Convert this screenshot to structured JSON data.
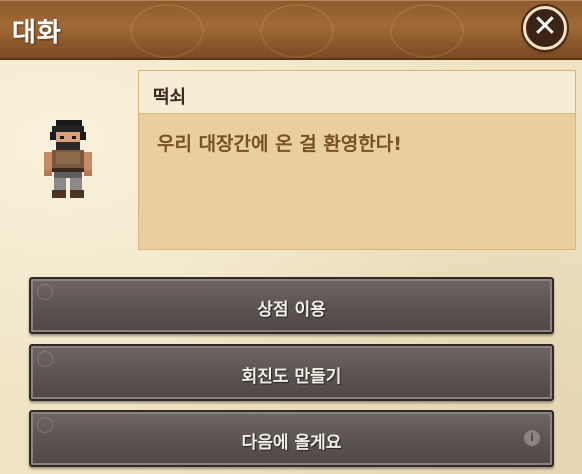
{
  "title_bar": {
    "title": "대화",
    "close_icon": "close-icon",
    "close_glyph": "✕"
  },
  "npc": {
    "portrait_icon": "npc-portrait"
  },
  "dialogue": {
    "speaker": "떡쇠",
    "text": "우리 대장간에 온 걸 환영한다!"
  },
  "options": [
    {
      "label": "상점 이용"
    },
    {
      "label": "회진도 만들기"
    },
    {
      "label": "다음에 올게요",
      "info_icon": "info-icon",
      "info_glyph": "i"
    }
  ],
  "colors": {
    "title_bar": "#8e5a2c",
    "panel_bg": "#efe3c3",
    "speech_bg": "#e8cf9c",
    "speech_text": "#7a5028",
    "button_bg": "#5c5552"
  }
}
